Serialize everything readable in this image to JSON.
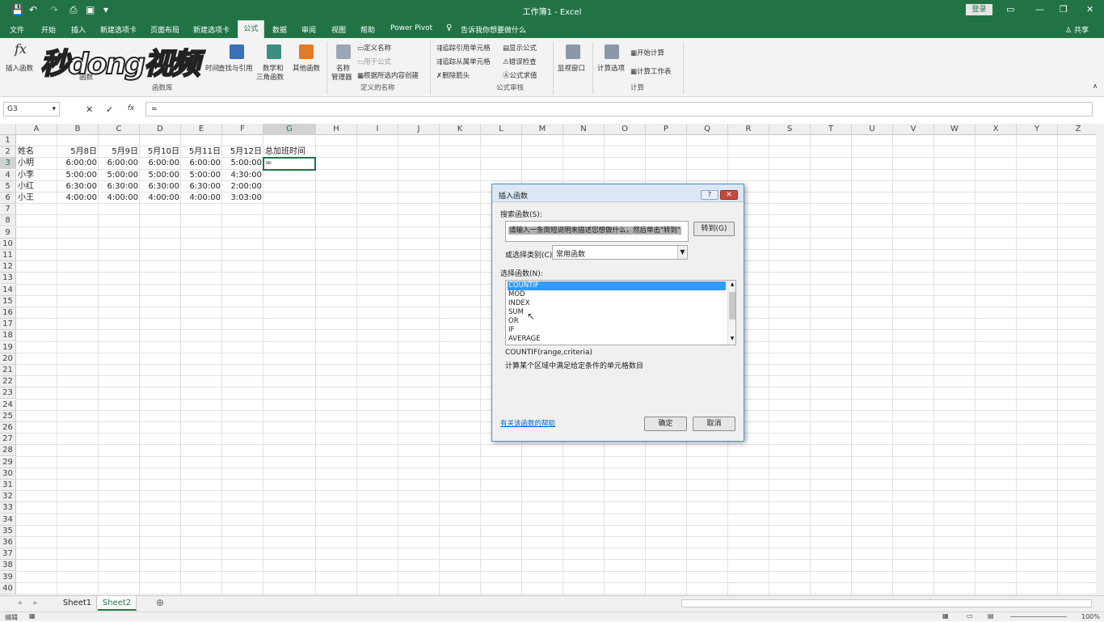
{
  "window": {
    "title": "工作簿1 - Excel",
    "login_label": "登录",
    "share_label": "共享"
  },
  "ribbon_tabs": [
    "文件",
    "开始",
    "插入",
    "新建选项卡",
    "页面布局",
    "新建选项卡",
    "公式",
    "数据",
    "审阅",
    "视图",
    "帮助",
    "Power Pivot",
    "告诉我你想要做什么"
  ],
  "ribbon": {
    "insert_function": "插入函数",
    "func_label": "函数",
    "time": "时间",
    "lookup": "查找与引用",
    "math_a": "数学和",
    "math_b": "三角函数",
    "other": "其他函数",
    "group_library": "函数库",
    "name_mgr_a": "名称",
    "name_mgr_b": "管理器",
    "define_name": "定义名称",
    "use_in_formula": "用于公式",
    "create_from_sel": "根据所选内容创建",
    "group_names": "定义的名称",
    "trace_precedents": "追踪引用单元格",
    "trace_dependents": "追踪从属单元格",
    "remove_arrows": "删除箭头",
    "show_formulas": "显示公式",
    "error_checking": "错误检查",
    "evaluate": "公式求值",
    "group_audit": "公式审核",
    "watch_window": "监视窗口",
    "calc_options": "计算选项",
    "calc_now": "开始计算",
    "calc_sheet": "计算工作表",
    "group_calc": "计算"
  },
  "watermark": "秒dong视频",
  "formula_bar": {
    "name_box": "G3",
    "formula": "="
  },
  "columns": [
    "A",
    "B",
    "C",
    "D",
    "E",
    "F",
    "G",
    "H",
    "I",
    "J",
    "K",
    "L",
    "M",
    "N",
    "O",
    "P",
    "Q",
    "R",
    "S",
    "T",
    "U",
    "V",
    "W",
    "X",
    "Y",
    "Z"
  ],
  "rows": [
    "1",
    "2",
    "3",
    "4",
    "5",
    "6",
    "7",
    "8",
    "9",
    "10",
    "11",
    "12",
    "13",
    "14",
    "15",
    "16",
    "17",
    "18",
    "19",
    "20",
    "21",
    "22",
    "23",
    "24",
    "25",
    "26",
    "27",
    "28",
    "29",
    "30",
    "31",
    "32",
    "33",
    "34",
    "35",
    "36",
    "37",
    "38",
    "39",
    "40"
  ],
  "sheet": {
    "headers": [
      "姓名",
      "5月8日",
      "5月9日",
      "5月10日",
      "5月11日",
      "5月12日",
      "总加班时间"
    ],
    "data": [
      [
        "小明",
        "6:00:00",
        "6:00:00",
        "6:00:00",
        "6:00:00",
        "5:00:00",
        "="
      ],
      [
        "小李",
        "5:00:00",
        "5:00:00",
        "5:00:00",
        "5:00:00",
        "4:30:00",
        ""
      ],
      [
        "小红",
        "6:30:00",
        "6:30:00",
        "6:30:00",
        "6:30:00",
        "2:00:00",
        ""
      ],
      [
        "小王",
        "4:00:00",
        "4:00:00",
        "4:00:00",
        "4:00:00",
        "3:03:00",
        ""
      ]
    ]
  },
  "sheet_tabs": [
    "Sheet1",
    "Sheet2"
  ],
  "status": {
    "mode": "编辑",
    "zoom": "100%"
  },
  "dialog": {
    "title": "插入函数",
    "help": "?",
    "close": "✕",
    "search_label": "搜索函数(S):",
    "search_value": "请输入一条简短说明来描述您想做什么，然后单击\"转到\"",
    "goto_button": "转到(G)",
    "category_label": "或选择类别(C):",
    "category_value": "常用函数",
    "list_label": "选择函数(N):",
    "functions": [
      "COUNTIF",
      "MOD",
      "INDEX",
      "SUM",
      "OR",
      "IF",
      "AVERAGE"
    ],
    "signature": "COUNTIF(range,criteria)",
    "description": "计算某个区域中满足给定条件的单元格数目",
    "help_link": "有关该函数的帮助",
    "ok": "确定",
    "cancel": "取消"
  }
}
